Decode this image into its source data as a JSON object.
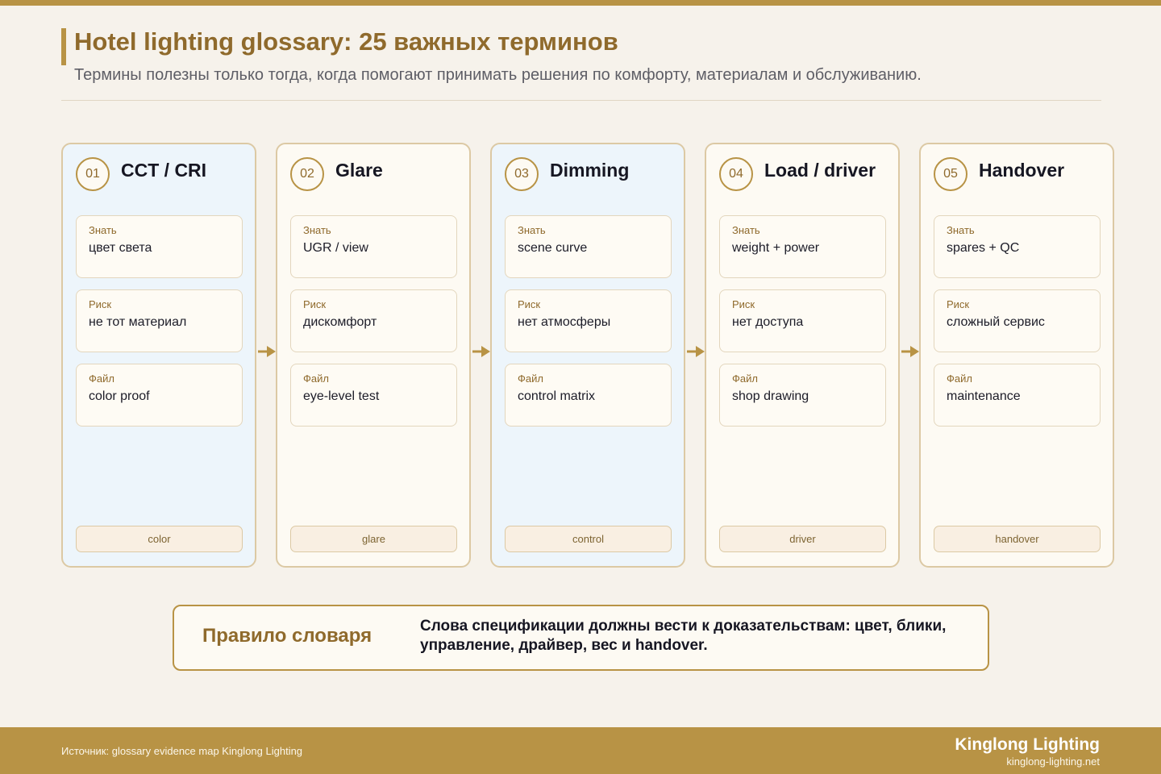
{
  "header": {
    "title": "Hotel lighting glossary: 25 важных терминов",
    "subtitle": "Термины полезны только тогда, когда помогают принимать решения по комфорту, материалам и обслуживанию."
  },
  "colors": {
    "accent": "#b89345",
    "accent_dark": "#8f6a2c",
    "background": "#f6f2eb",
    "card_blue": "#edf5fb",
    "card_cream": "#fdfaf3"
  },
  "cards": [
    {
      "number": "01",
      "title": "CCT / CRI",
      "know_label": "Знать",
      "know": "цвет света",
      "risk_label": "Риск",
      "risk": "не тот материал",
      "file_label": "Файл",
      "file": "color proof",
      "tag": "color"
    },
    {
      "number": "02",
      "title": "Glare",
      "know_label": "Знать",
      "know": "UGR / view",
      "risk_label": "Риск",
      "risk": "дискомфорт",
      "file_label": "Файл",
      "file": "eye-level test",
      "tag": "glare"
    },
    {
      "number": "03",
      "title": "Dimming",
      "know_label": "Знать",
      "know": "scene curve",
      "risk_label": "Риск",
      "risk": "нет атмосферы",
      "file_label": "Файл",
      "file": "control matrix",
      "tag": "control"
    },
    {
      "number": "04",
      "title": "Load / driver",
      "know_label": "Знать",
      "know": "weight + power",
      "risk_label": "Риск",
      "risk": "нет доступа",
      "file_label": "Файл",
      "file": "shop drawing",
      "tag": "driver"
    },
    {
      "number": "05",
      "title": "Handover",
      "know_label": "Знать",
      "know": "spares + QC",
      "risk_label": "Риск",
      "risk": "сложный сервис",
      "file_label": "Файл",
      "file": "maintenance",
      "tag": "handover"
    }
  ],
  "rule": {
    "title": "Правило словаря",
    "text": "Слова спецификации должны вести к доказательствам: цвет, блики, управление, драйвер, вес и handover."
  },
  "footer": {
    "source": "Источник: glossary evidence map Kinglong Lighting",
    "brand": "Kinglong Lighting",
    "url": "kinglong-lighting.net"
  }
}
